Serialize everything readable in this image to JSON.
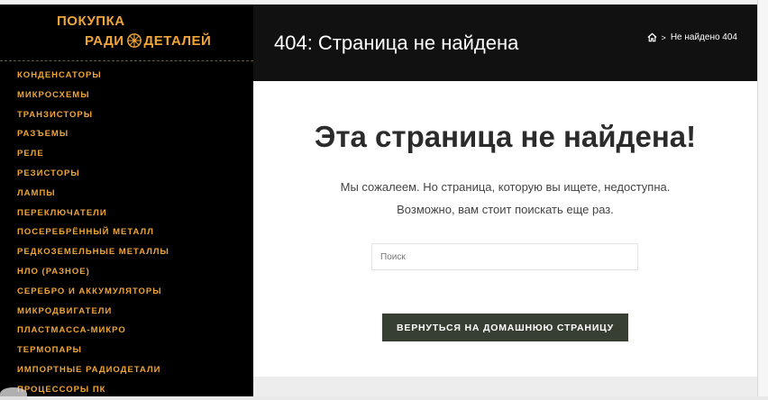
{
  "logo": {
    "line1": "ПОКУПКА",
    "line2_left": "РАДИ",
    "line2_right": "ДЕТАЛЕЙ"
  },
  "sidebar": {
    "items": [
      "КОНДЕНСАТОРЫ",
      "МИКРОСХЕМЫ",
      "ТРАНЗИСТОРЫ",
      "РАЗЪЕМЫ",
      "РЕЛЕ",
      "РЕЗИСТОРЫ",
      "ЛАМПЫ",
      "ПЕРЕКЛЮЧАТЕЛИ",
      "ПОСЕРЕБРЁННЫЙ МЕТАЛЛ",
      "РЕДКОЗЕМЕЛЬНЫЕ МЕТАЛЛЫ",
      "НЛО (РАЗНОЕ)",
      "СЕРЕБРО И АККУМУЛЯТОРЫ",
      "МИКРОДВИГАТЕЛИ",
      "ПЛАСТМАССА-МИКРО",
      "ТЕРМОПАРЫ",
      "ИМПОРТНЫЕ РАДИОДЕТАЛИ",
      "ПРОЦЕССОРЫ ПК"
    ]
  },
  "header": {
    "title": "404: Страница не найдена",
    "breadcrumb_current": "Не найдено 404",
    "breadcrumb_separator": ">"
  },
  "main": {
    "headline": "Эта страница не найдена!",
    "message_line1": "Мы сожалеем. Но страница, которую вы ищете, недоступна.",
    "message_line2": "Возможно, вам стоит поискать еще раз.",
    "search_placeholder": "Поиск",
    "home_button": "ВЕРНУТЬСЯ НА ДОМАШНЮЮ СТРАНИЦУ"
  },
  "colors": {
    "sidebar_text": "#f0a537",
    "header_bg": "#111111",
    "button_bg": "#373f32"
  }
}
